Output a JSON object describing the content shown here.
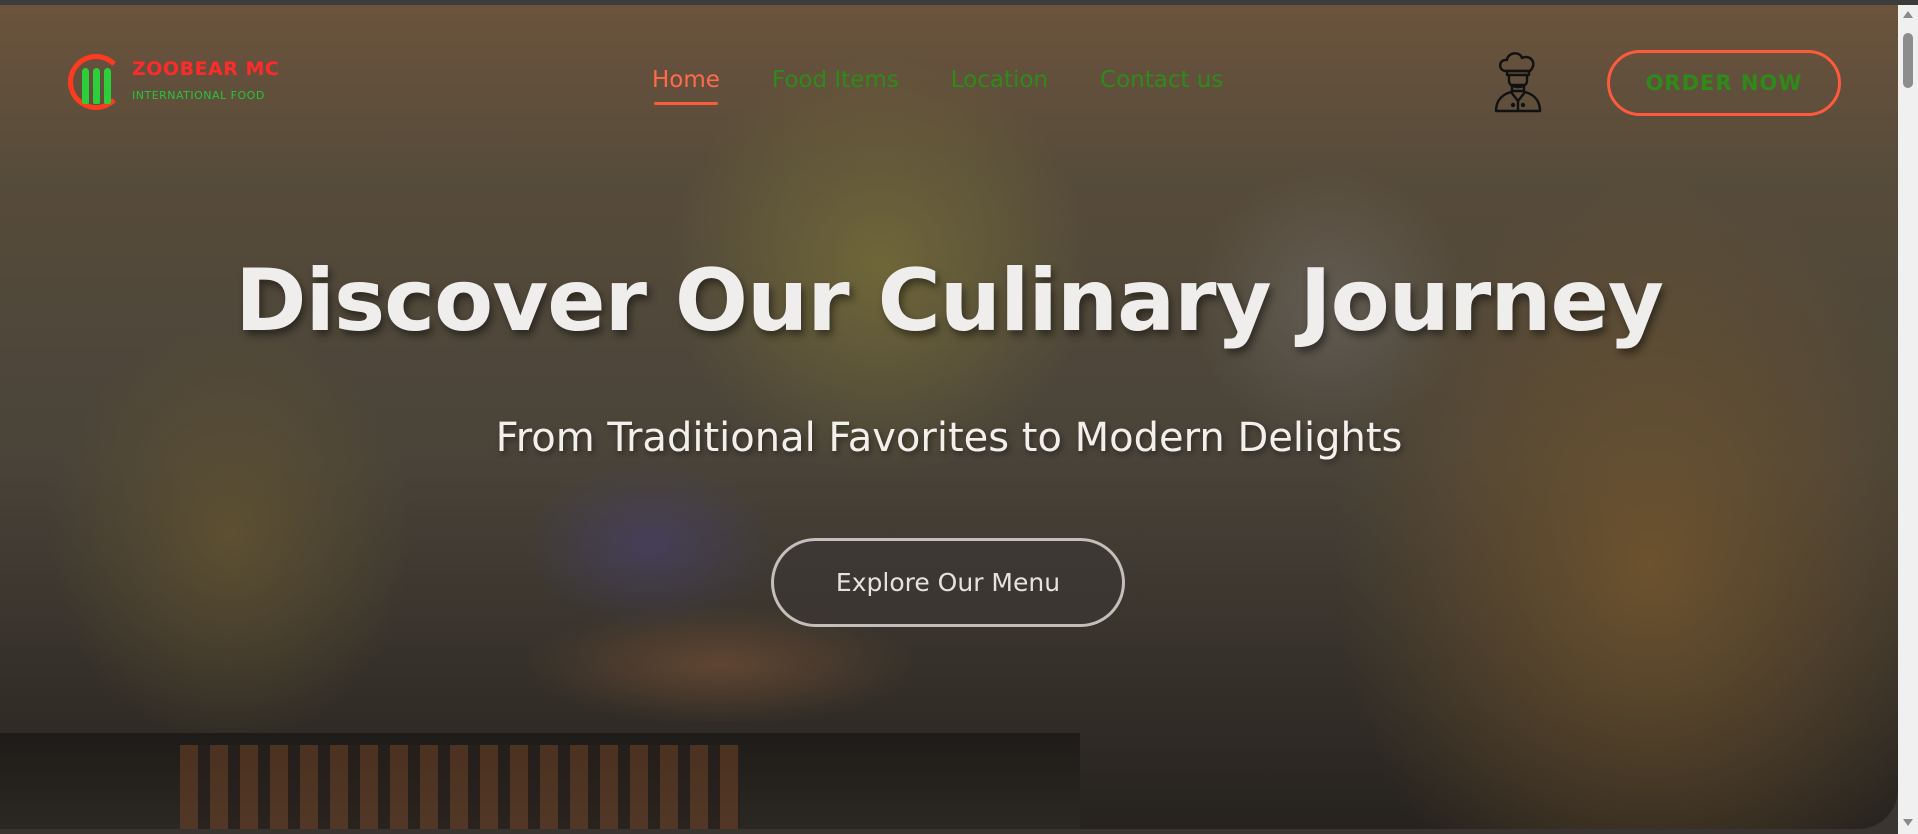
{
  "header": {
    "logo": {
      "name": "ZOOBEAR MC",
      "tagline": "INTERNATIONAL FOOD"
    },
    "nav": [
      {
        "label": "Home",
        "active": true
      },
      {
        "label": "Food Items",
        "active": false
      },
      {
        "label": "Location",
        "active": false
      },
      {
        "label": "Contact us",
        "active": false
      }
    ],
    "account_icon": "chef-icon",
    "order_button": "ORDER NOW"
  },
  "hero": {
    "title": "Discover Our Culinary Journey",
    "subtitle": "From Traditional Favorites to Modern Delights",
    "cta": "Explore Our Menu"
  },
  "colors": {
    "accent": "#ff5a3c",
    "nav_text": "#2f8a1a",
    "logo_red": "#ff2a2a",
    "logo_green": "#27c43a"
  }
}
